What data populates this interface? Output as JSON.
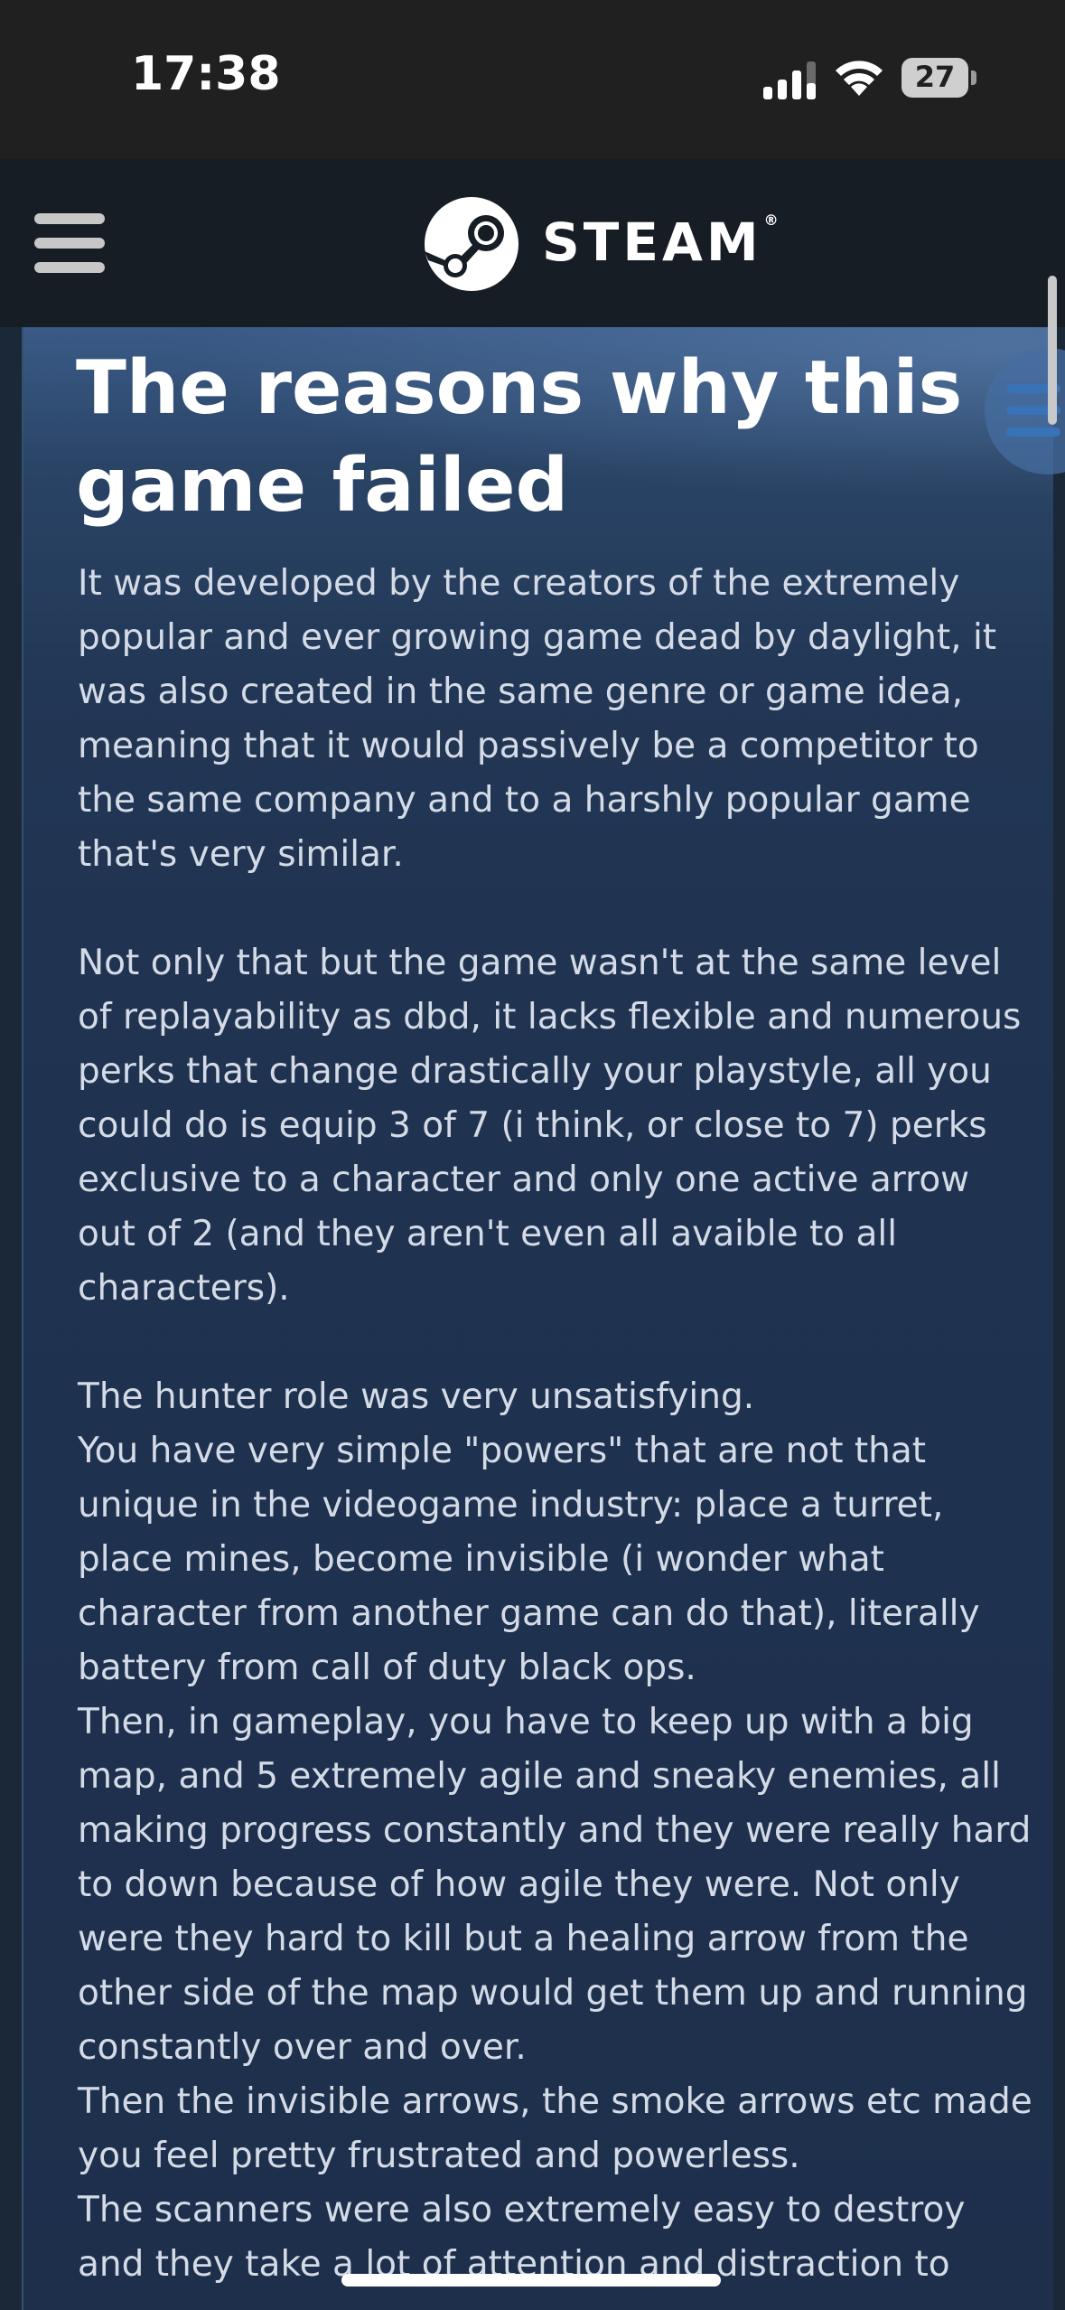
{
  "status_bar": {
    "time": "17:38",
    "battery": "27",
    "icons": [
      "signal-icon",
      "wifi-icon",
      "battery-icon"
    ]
  },
  "header": {
    "brand": "STEAM",
    "registered_mark": "®",
    "icons": [
      "menu-icon",
      "steam-logo-icon"
    ]
  },
  "guide": {
    "title": "The reasons why this game failed",
    "paragraphs": [
      "It was developed by the creators of the extremely popular and ever growing game dead by daylight, it was also created in the same genre or game idea, meaning that it would passively be a competitor to the same company and to a harshly popular game that's very similar.",
      "Not only that but the game wasn't at the same level of replayability as dbd, it lacks flexible and numerous perks that change drastically your playstyle, all you could do is equip 3 of 7 (i think, or close to 7) perks exclusive to a character and only one active arrow out of 2 (and they aren't even all avaible to all characters).",
      "The hunter role was very unsatisfying.\nYou have very simple \"powers\" that are not that unique in the videogame industry: place a turret, place mines, become invisible (i wonder what character from another game can do that), literally battery from call of duty black ops.\nThen, in gameplay, you have to keep up with a big map, and 5 extremely agile and sneaky enemies, all making progress constantly and they were really hard to down because of how agile they were. Not only were they hard to kill but a healing arrow from the other side of the map would get them up and running constantly over and over.\nThen the invisible arrows, the smoke arrows etc made you feel pretty frustrated and powerless.\nThe scanners were also extremely easy to destroy and they take a lot of attention and distraction to"
    ]
  },
  "colors": {
    "status_bar_bg": "#202020",
    "header_bg": "#171d25",
    "content_bg": "#1f3250",
    "body_text": "#d4dbe6",
    "title_text": "#ffffff"
  }
}
